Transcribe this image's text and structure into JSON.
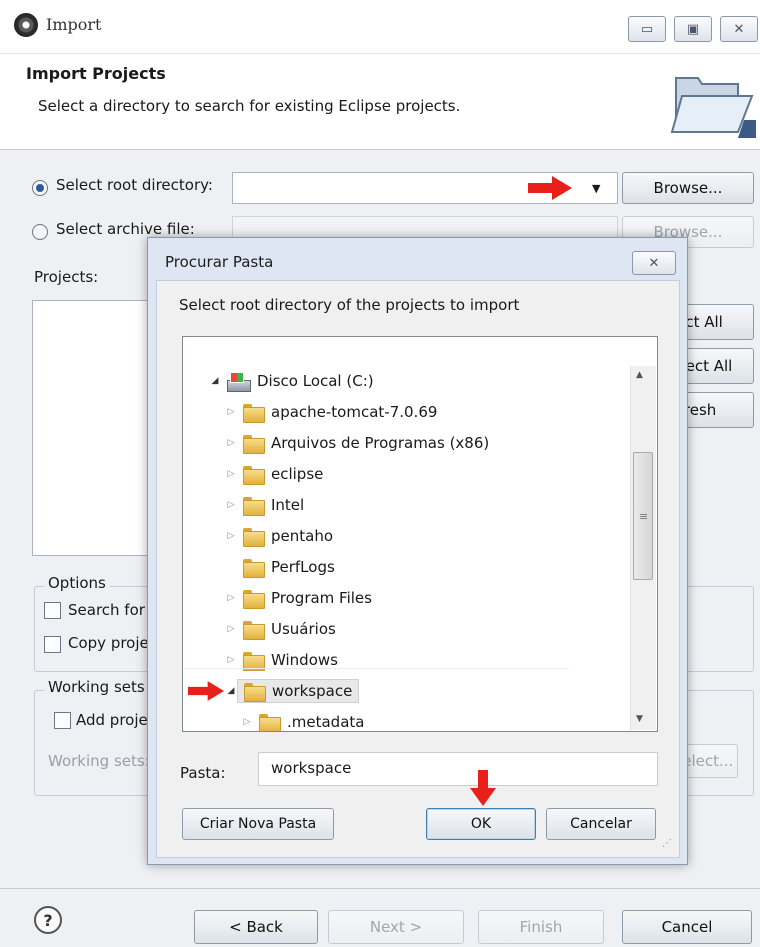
{
  "main": {
    "title": "Import",
    "header_title": "Import Projects",
    "header_subtitle": "Select a directory to search for existing Eclipse projects.",
    "select_root_label": "Select root directory:",
    "select_root_value": "",
    "select_archive_label": "Select archive file:",
    "browse_label": "Browse...",
    "browse_label_disabled": "Browse...",
    "projects_label": "Projects:",
    "select_all_label": "Select All",
    "deselect_all_label": "Deselect All",
    "refresh_label": "Refresh",
    "options_label": "Options",
    "search_nested_label": "Search for nested projects",
    "copy_projects_label": "Copy projects into workspace",
    "working_sets_label": "Working sets",
    "add_project_label": "Add project to working sets",
    "working_sets_field_label": "Working sets:",
    "select_working_sets_label": "Select...",
    "footer": {
      "help": "?",
      "back": "< Back",
      "next": "Next >",
      "finish": "Finish",
      "cancel": "Cancel"
    },
    "window_buttons": {
      "minimize": "▭",
      "maximize": "▣",
      "close": "✕"
    }
  },
  "dialog": {
    "title": "Procurar Pasta",
    "close": "✕",
    "description": "Select root directory of the projects to import",
    "tree": [
      {
        "label": "Disco Local (C:)",
        "type": "drive",
        "expanded": true,
        "level": 0
      },
      {
        "label": "apache-tomcat-7.0.69",
        "type": "folder",
        "level": 1
      },
      {
        "label": "Arquivos de Programas (x86)",
        "type": "folder",
        "level": 1
      },
      {
        "label": "eclipse",
        "type": "folder",
        "level": 1
      },
      {
        "label": "Intel",
        "type": "folder",
        "level": 1
      },
      {
        "label": "pentaho",
        "type": "folder",
        "level": 1
      },
      {
        "label": "PerfLogs",
        "type": "folder",
        "level": 1,
        "no_children": true
      },
      {
        "label": "Program Files",
        "type": "folder",
        "level": 1
      },
      {
        "label": "Usuários",
        "type": "folder",
        "level": 1
      },
      {
        "label": "Windows",
        "type": "folder",
        "level": 1
      },
      {
        "label": "workspace",
        "type": "folder",
        "level": 1,
        "expanded": true,
        "selected": true
      },
      {
        "label": ".metadata",
        "type": "folder",
        "level": 2
      }
    ],
    "pasta_label": "Pasta:",
    "pasta_value": "workspace",
    "new_folder_label": "Criar Nova Pasta",
    "ok_label": "OK",
    "cancel_label": "Cancelar"
  },
  "annotations": {
    "arrow_color": "#e8201a"
  },
  "icons": {
    "app": "eclipse-icon",
    "banner": "folder-import-icon",
    "help": "help-icon",
    "drive": "local-disk-icon",
    "folder": "folder-icon"
  }
}
